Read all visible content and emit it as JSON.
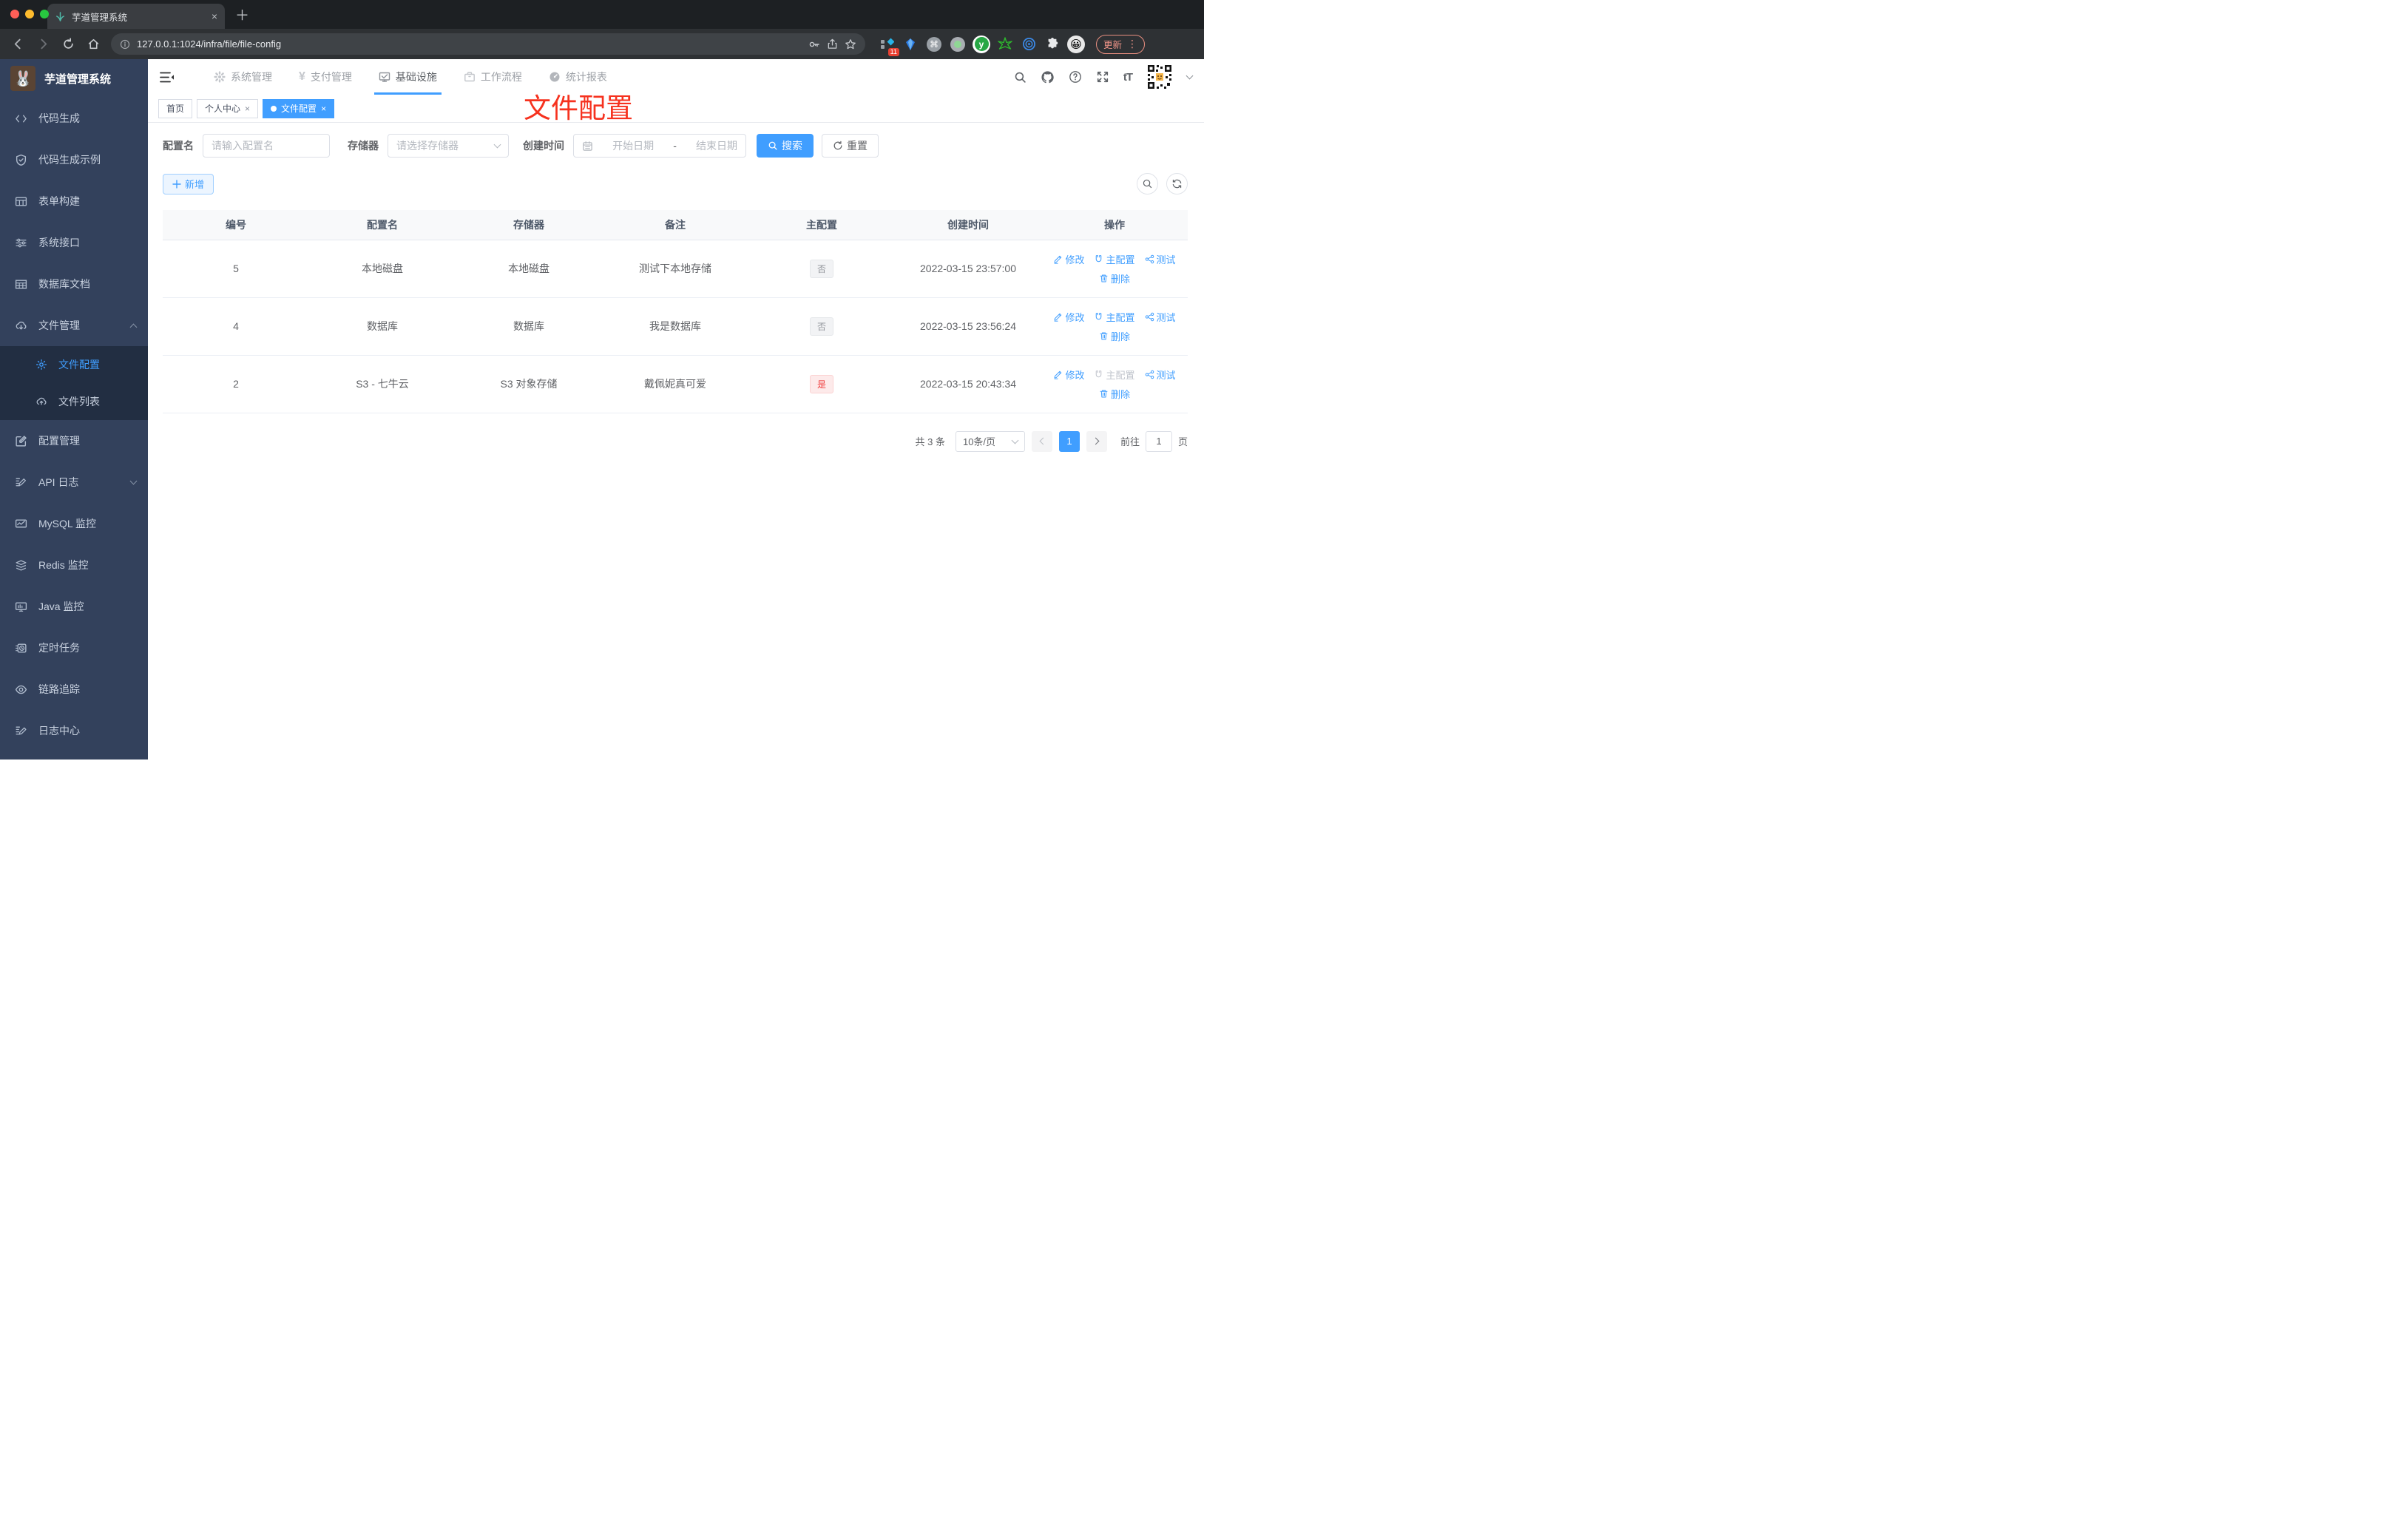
{
  "colors": {
    "primary": "#409eff",
    "danger": "#f03e3e",
    "annotation_red": "#f6321f",
    "sidebar_bg": "#33415c",
    "sidebar_submenu_bg": "#222e42",
    "update_accent": "#ee9488"
  },
  "browser": {
    "tab_title": "芋道管理系统",
    "url": "127.0.0.1:1024/infra/file/file-config",
    "update_label": "更新",
    "extension_badge": "11"
  },
  "icons": {
    "close": "×",
    "plus": "＋",
    "kebab": "⋮",
    "cmd": "⌘",
    "yen": "¥",
    "font_size": "tT",
    "ext_y": "y",
    "emoji_face": "😀",
    "logo_rabbit": "🐰",
    "plant": "🌱",
    "qr_center": "🐶"
  },
  "sidebar": {
    "app_title": "芋道管理系统",
    "items": [
      {
        "label": "代码生成",
        "icon": "code-icon"
      },
      {
        "label": "代码生成示例",
        "icon": "shield-check-icon"
      },
      {
        "label": "表单构建",
        "icon": "form-icon"
      },
      {
        "label": "系统接口",
        "icon": "sliders-icon"
      },
      {
        "label": "数据库文档",
        "icon": "grid-icon"
      },
      {
        "label": "文件管理",
        "icon": "cloud-download-icon",
        "expanded": true,
        "children": [
          {
            "label": "文件配置",
            "icon": "gear-icon",
            "active": true
          },
          {
            "label": "文件列表",
            "icon": "cloud-upload-icon"
          }
        ]
      },
      {
        "label": "配置管理",
        "icon": "edit-square-icon"
      },
      {
        "label": "API 日志",
        "icon": "doc-edit-icon",
        "collapsed": true
      },
      {
        "label": "MySQL 监控",
        "icon": "chart-monitor-icon"
      },
      {
        "label": "Redis 监控",
        "icon": "stack-icon"
      },
      {
        "label": "Java 监控",
        "icon": "monitor-icon"
      },
      {
        "label": "定时任务",
        "icon": "schedule-icon"
      },
      {
        "label": "链路追踪",
        "icon": "eye-icon"
      },
      {
        "label": "日志中心",
        "icon": "log-edit-icon"
      }
    ]
  },
  "topnav": {
    "items": [
      {
        "label": "系统管理",
        "icon": "gear-icon"
      },
      {
        "label": "支付管理",
        "icon": "yen-icon"
      },
      {
        "label": "基础设施",
        "icon": "monitor-check-icon",
        "active": true
      },
      {
        "label": "工作流程",
        "icon": "briefcase-icon"
      },
      {
        "label": "统计报表",
        "icon": "gauge-icon"
      }
    ]
  },
  "tags": {
    "home": "首页",
    "profile": "个人中心",
    "current": "文件配置"
  },
  "annotation": {
    "text": "文件配置"
  },
  "filters": {
    "name_label": "配置名",
    "name_placeholder": "请输入配置名",
    "storage_label": "存储器",
    "storage_placeholder": "请选择存储器",
    "time_label": "创建时间",
    "start_placeholder": "开始日期",
    "range_separator": "-",
    "end_placeholder": "结束日期",
    "search_label": "搜索",
    "reset_label": "重置"
  },
  "toolbar": {
    "add_label": "新增"
  },
  "table": {
    "headers": [
      "编号",
      "配置名",
      "存储器",
      "备注",
      "主配置",
      "创建时间",
      "操作"
    ],
    "action_labels": {
      "edit": "修改",
      "master": "主配置",
      "test": "测试",
      "delete": "删除"
    },
    "rows": [
      {
        "id": "5",
        "name": "本地磁盘",
        "storage": "本地磁盘",
        "remark": "测试下本地存储",
        "master": "否",
        "created": "2022-03-15 23:57:00"
      },
      {
        "id": "4",
        "name": "数据库",
        "storage": "数据库",
        "remark": "我是数据库",
        "master": "否",
        "created": "2022-03-15 23:56:24"
      },
      {
        "id": "2",
        "name": "S3 - 七牛云",
        "storage": "S3 对象存储",
        "remark": "戴佩妮真可爱",
        "master": "是",
        "created": "2022-03-15 20:43:34"
      }
    ]
  },
  "pagination": {
    "total": "共 3 条",
    "page_size": "10条/页",
    "current_page": "1",
    "goto_label": "前往",
    "goto_value": "1",
    "page_unit": "页"
  }
}
